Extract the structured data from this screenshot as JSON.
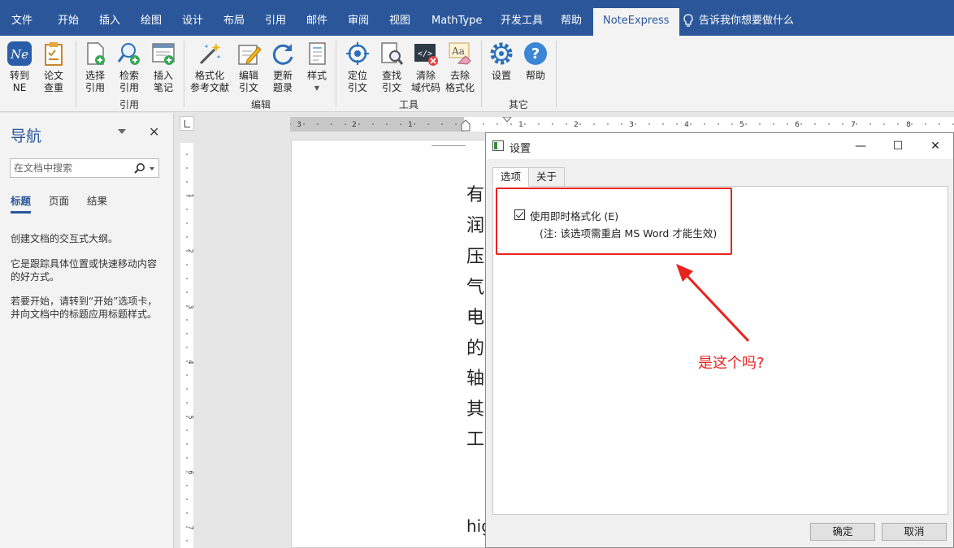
{
  "ribbon_tabs": [
    "文件",
    "开始",
    "插入",
    "绘图",
    "设计",
    "布局",
    "引用",
    "邮件",
    "审阅",
    "视图",
    "MathType",
    "开发工具",
    "帮助",
    "NoteExpress"
  ],
  "active_tab": "NoteExpress",
  "tell_me": "告诉我你想要做什么",
  "ribbon": {
    "buttons": [
      {
        "line1": "转到",
        "line2": "NE",
        "icon": "noteexpress-logo-icon"
      },
      {
        "line1": "论文",
        "line2": "查重",
        "icon": "clipboard-check-icon"
      },
      {
        "line1": "选择",
        "line2": "引用",
        "icon": "select-citation-icon"
      },
      {
        "line1": "检索",
        "line2": "引用",
        "icon": "search-citation-icon"
      },
      {
        "line1": "插入",
        "line2": "笔记",
        "icon": "insert-note-icon"
      },
      {
        "line1": "格式化",
        "line2": "参考文献",
        "icon": "format-magic-wand-icon"
      },
      {
        "line1": "编辑",
        "line2": "引文",
        "icon": "edit-citation-icon"
      },
      {
        "line1": "更新",
        "line2": "题录",
        "icon": "refresh-icon"
      },
      {
        "line1": "样式",
        "line2": "",
        "icon": "style-icon"
      },
      {
        "line1": "定位",
        "line2": "引文",
        "icon": "locate-icon"
      },
      {
        "line1": "查找",
        "line2": "引文",
        "icon": "find-citation-icon"
      },
      {
        "line1": "清除",
        "line2": "域代码",
        "icon": "clear-field-code-icon"
      },
      {
        "line1": "去除",
        "line2": "格式化",
        "icon": "remove-format-icon"
      },
      {
        "line1": "设置",
        "line2": "",
        "icon": "settings-gear-icon"
      },
      {
        "line1": "帮助",
        "line2": "",
        "icon": "help-icon"
      }
    ],
    "groups": [
      "引用",
      "编辑",
      "工具",
      "其它"
    ]
  },
  "nav": {
    "title": "导航",
    "search_placeholder": "在文档中搜索",
    "tabs": [
      "标题",
      "页面",
      "结果"
    ],
    "text1": "创建文档的交互式大纲。",
    "text2": "它是跟踪具体位置或快速移动内容的好方式。",
    "text3": "若要开始，请转到“开始”选项卡，并向文档中的标题应用标题样式。"
  },
  "ruler": {
    "h_numbers": [
      "3",
      "2",
      "1",
      "1",
      "2",
      "3",
      "4",
      "5",
      "6",
      "7",
      "8"
    ],
    "v_numbers": [
      "1",
      "2",
      "3",
      "4",
      "5",
      "6",
      "7"
    ]
  },
  "document_chars": [
    "有",
    "润",
    "压",
    "气",
    "电",
    "的",
    "轴",
    "其",
    "工",
    "hig"
  ],
  "dialog": {
    "title": "设置",
    "tabs": [
      "选项",
      "关于"
    ],
    "checkbox_label": "使用即时格式化 (E)",
    "checkbox_checked": true,
    "note": "(注: 该选项需重启 MS Word 才能生效)",
    "ok": "确定",
    "cancel": "取消"
  },
  "annotation": "是这个吗?",
  "colors": {
    "ribbon_blue": "#2b579a",
    "annotation_red": "#e8231e"
  }
}
